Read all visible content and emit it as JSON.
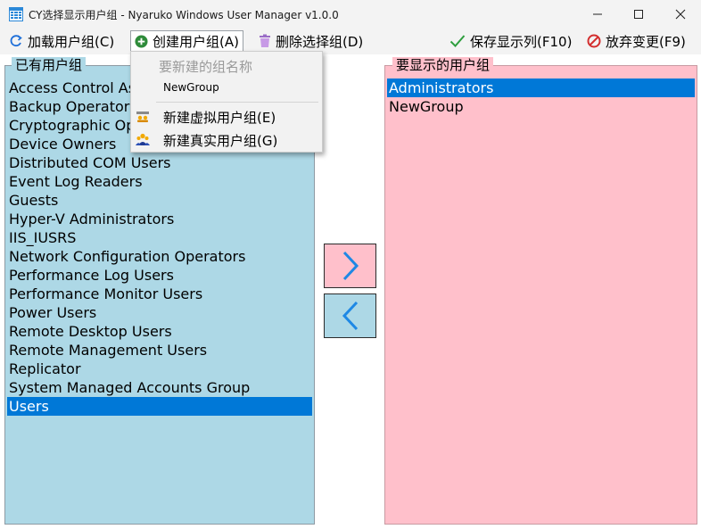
{
  "window": {
    "title": "CY选择显示用户组 - Nyaruko Windows User Manager v1.0.0"
  },
  "toolbar": {
    "load_label": "加载用户组(C)",
    "create_label": "创建用户组(A)",
    "delete_label": "删除选择组(D)",
    "save_label": "保存显示列(F10)",
    "discard_label": "放弃变更(F9)"
  },
  "dropdown": {
    "placeholder": "要新建的组名称",
    "value": "NewGroup",
    "items": [
      {
        "label": "新建虚拟用户组(E)",
        "icon": "virtual-group-icon"
      },
      {
        "label": "新建真实用户组(G)",
        "icon": "real-group-icon"
      }
    ]
  },
  "left_panel": {
    "title": "已有用户组",
    "items": [
      "Access Control Assistance Operators",
      "Backup Operators",
      "Cryptographic Operators",
      "Device Owners",
      "Distributed COM Users",
      "Event Log Readers",
      "Guests",
      "Hyper-V Administrators",
      "IIS_IUSRS",
      "Network Configuration Operators",
      "Performance Log Users",
      "Performance Monitor Users",
      "Power Users",
      "Remote Desktop Users",
      "Remote Management Users",
      "Replicator",
      "System Managed Accounts Group",
      "Users"
    ],
    "selected": "Users"
  },
  "right_panel": {
    "title": "要显示的用户组",
    "items": [
      "Administrators",
      "NewGroup"
    ],
    "selected": "Administrators"
  },
  "colors": {
    "left_bg": "#add8e6",
    "right_bg": "#ffc0cb",
    "selection": "#0078d7",
    "arrow": "#1e88e5",
    "save_check": "#2e9e3e",
    "discard_red": "#d32f2f",
    "create_green": "#2e8b3a",
    "delete_purple": "#b57edc"
  }
}
